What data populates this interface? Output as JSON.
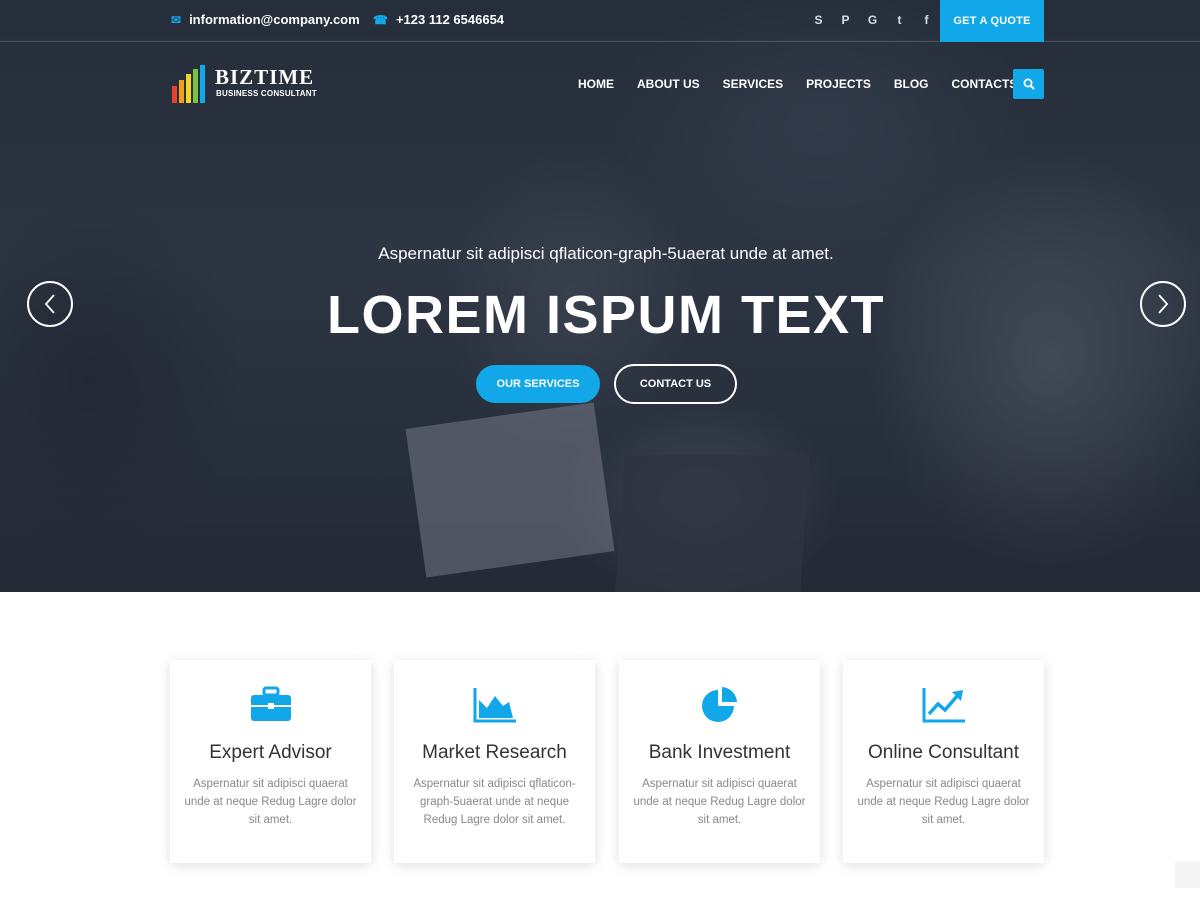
{
  "topbar": {
    "email": "information@company.com",
    "email_icon": "envelope-icon",
    "phone": "+123 112 6546654",
    "phone_icon": "phone-icon",
    "social_icons": [
      "skype-icon",
      "pinterest-icon",
      "google-icon",
      "twitter-icon",
      "facebook-icon"
    ],
    "quote_button": "GET A QUOTE"
  },
  "logo": {
    "title": "BIZTIME",
    "subtitle": "BUSINESS CONSULTANT",
    "icon": "bar-chart-logo-icon"
  },
  "nav": {
    "items": [
      "HOME",
      "ABOUT US",
      "SERVICES",
      "PROJECTS",
      "BLOG",
      "CONTACTS"
    ],
    "search_icon": "search-icon"
  },
  "hero": {
    "subtitle": "Aspernatur sit adipisci qflaticon-graph-5uaerat unde at amet.",
    "title": "LOREM ISPUM TEXT",
    "primary_button": "OUR SERVICES",
    "secondary_button": "CONTACT US",
    "prev_icon": "chevron-left-icon",
    "next_icon": "chevron-right-icon"
  },
  "features": [
    {
      "icon": "briefcase-icon",
      "title": "Expert Advisor",
      "text": "Aspernatur sit adipisci quaerat unde at neque Redug Lagre dolor sit amet."
    },
    {
      "icon": "area-chart-icon",
      "title": "Market Research",
      "text": "Aspernatur sit adipisci qflaticon-graph-5uaerat unde at neque Redug Lagre dolor sit amet."
    },
    {
      "icon": "pie-chart-icon",
      "title": "Bank Investment",
      "text": "Aspernatur sit adipisci quaerat unde at neque Redug Lagre dolor sit amet."
    },
    {
      "icon": "line-chart-icon",
      "title": "Online Consultant",
      "text": "Aspernatur sit adipisci quaerat unde at neque Redug Lagre dolor sit amet."
    }
  ],
  "colors": {
    "accent": "#12a7e8",
    "hero_overlay": "#2e3746",
    "card_title": "#333333",
    "card_text": "#888888"
  }
}
